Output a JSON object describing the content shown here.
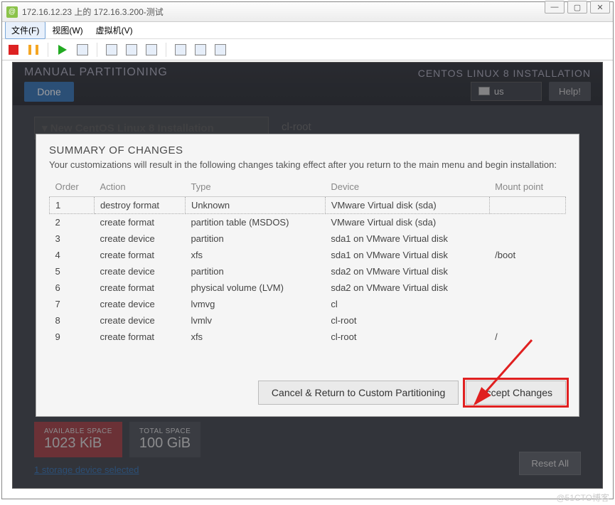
{
  "window": {
    "title": "172.16.12.23 上的 172.16.3.200-测试"
  },
  "menu": {
    "file": "文件(F)",
    "view": "视图(W)",
    "vm": "虚拟机(V)"
  },
  "installer": {
    "heading": "MANUAL PARTITIONING",
    "done": "Done",
    "brand": "CENTOS LINUX 8 INSTALLATION",
    "kb": "us",
    "help": "Help!",
    "accordion": "▾ New CentOS Linux 8 Installation",
    "clroot": "cl-root",
    "available_label": "AVAILABLE SPACE",
    "available_value": "1023 KiB",
    "total_label": "TOTAL SPACE",
    "total_value": "100 GiB",
    "storage_link": "1 storage device selected",
    "reset": "Reset All"
  },
  "dialog": {
    "title": "SUMMARY OF CHANGES",
    "desc": "Your customizations will result in the following changes taking effect after you return to the main menu and begin installation:",
    "headers": {
      "order": "Order",
      "action": "Action",
      "type": "Type",
      "device": "Device",
      "mount": "Mount point"
    },
    "rows": [
      {
        "order": "1",
        "action": "destroy format",
        "actionClass": "destroy",
        "type": "Unknown",
        "device": "VMware Virtual disk (sda)",
        "mount": ""
      },
      {
        "order": "2",
        "action": "create format",
        "actionClass": "create",
        "type": "partition table (MSDOS)",
        "device": "VMware Virtual disk (sda)",
        "mount": ""
      },
      {
        "order": "3",
        "action": "create device",
        "actionClass": "create",
        "type": "partition",
        "device": "sda1 on VMware Virtual disk",
        "mount": ""
      },
      {
        "order": "4",
        "action": "create format",
        "actionClass": "create",
        "type": "xfs",
        "device": "sda1 on VMware Virtual disk",
        "mount": "/boot"
      },
      {
        "order": "5",
        "action": "create device",
        "actionClass": "create",
        "type": "partition",
        "device": "sda2 on VMware Virtual disk",
        "mount": ""
      },
      {
        "order": "6",
        "action": "create format",
        "actionClass": "create",
        "type": "physical volume (LVM)",
        "device": "sda2 on VMware Virtual disk",
        "mount": ""
      },
      {
        "order": "7",
        "action": "create device",
        "actionClass": "create",
        "type": "lvmvg",
        "device": "cl",
        "mount": ""
      },
      {
        "order": "8",
        "action": "create device",
        "actionClass": "create",
        "type": "lvmlv",
        "device": "cl-root",
        "mount": ""
      },
      {
        "order": "9",
        "action": "create format",
        "actionClass": "create",
        "type": "xfs",
        "device": "cl-root",
        "mount": "/"
      }
    ],
    "cancel": "Cancel & Return to Custom Partitioning",
    "accept": "Accept Changes"
  },
  "watermark": "@51CTO博客"
}
